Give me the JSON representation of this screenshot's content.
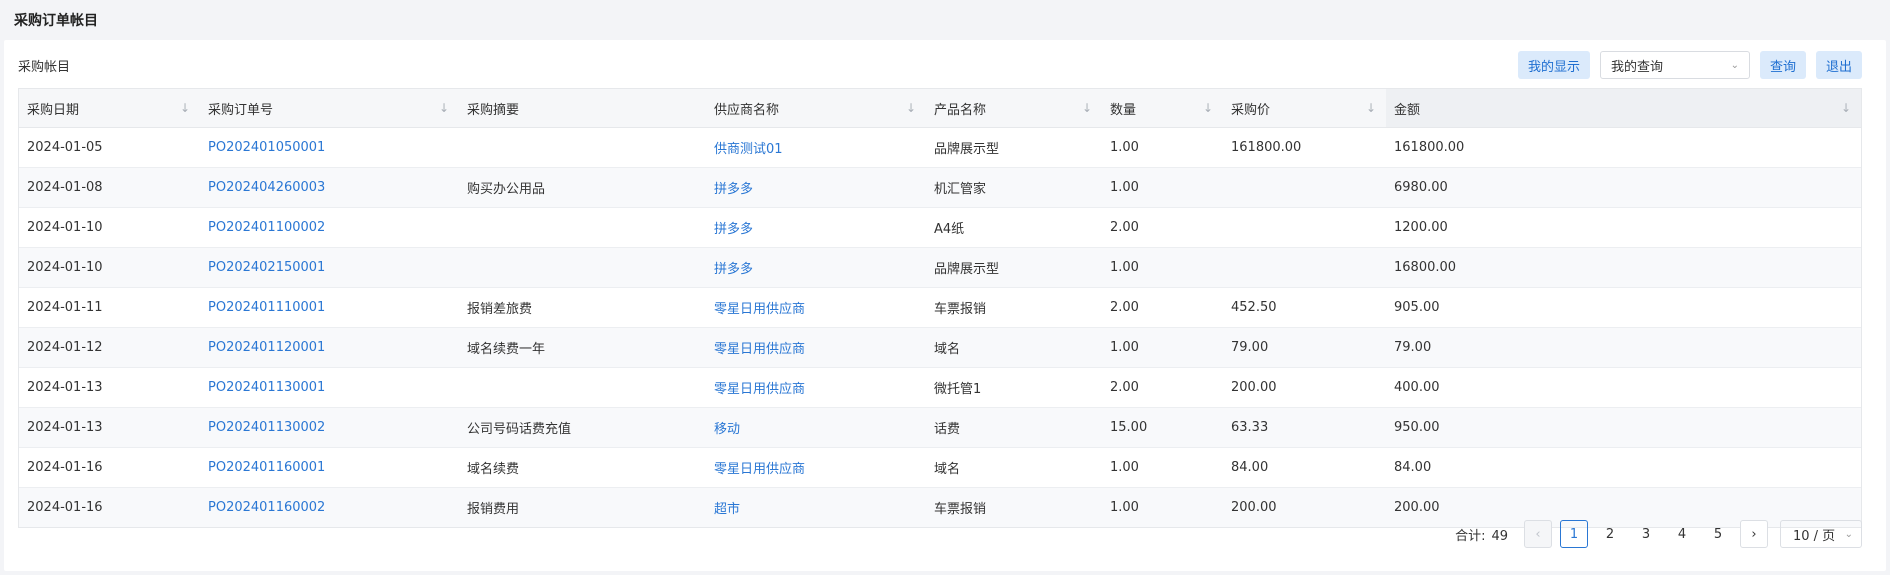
{
  "page": {
    "title": "采购订单帐目"
  },
  "toolbar": {
    "title": "采购帐目",
    "my_display_label": "我的显示",
    "my_query_selected": "我的查询",
    "query_label": "查询",
    "exit_label": "退出"
  },
  "table": {
    "columns": [
      "采购日期",
      "采购订单号",
      "采购摘要",
      "供应商名称",
      "产品名称",
      "数量",
      "采购价",
      "金额"
    ],
    "rows": [
      [
        "2024-01-05",
        "PO202401050001",
        "",
        "供商测试01",
        "品牌展示型",
        "1.00",
        "161800.00",
        "161800.00"
      ],
      [
        "2024-01-08",
        "PO202404260003",
        "购买办公用品",
        "拼多多",
        "机汇管家",
        "1.00",
        "",
        "6980.00"
      ],
      [
        "2024-01-10",
        "PO202401100002",
        "",
        "拼多多",
        "A4纸",
        "2.00",
        "",
        "1200.00"
      ],
      [
        "2024-01-10",
        "PO202402150001",
        "",
        "拼多多",
        "品牌展示型",
        "1.00",
        "",
        "16800.00"
      ],
      [
        "2024-01-11",
        "PO202401110001",
        "报销差旅费",
        "零星日用供应商",
        "车票报销",
        "2.00",
        "452.50",
        "905.00"
      ],
      [
        "2024-01-12",
        "PO202401120001",
        "域名续费一年",
        "零星日用供应商",
        "域名",
        "1.00",
        "79.00",
        "79.00"
      ],
      [
        "2024-01-13",
        "PO202401130001",
        "",
        "零星日用供应商",
        "微托管1",
        "2.00",
        "200.00",
        "400.00"
      ],
      [
        "2024-01-13",
        "PO202401130002",
        "公司号码话费充值",
        "移动",
        "话费",
        "15.00",
        "63.33",
        "950.00"
      ],
      [
        "2024-01-16",
        "PO202401160001",
        "域名续费",
        "零星日用供应商",
        "域名",
        "1.00",
        "84.00",
        "84.00"
      ],
      [
        "2024-01-16",
        "PO202401160002",
        "报销费用",
        "超市",
        "车票报销",
        "1.00",
        "200.00",
        "200.00"
      ]
    ]
  },
  "pagination": {
    "total_label": "合计:",
    "total": "49",
    "pages": [
      "1",
      "2",
      "3",
      "4",
      "5"
    ],
    "current": "1",
    "page_size": "10 / 页"
  },
  "icons": {
    "sort": "arrow-down-icon",
    "dropdown": "chevron-down-icon",
    "prev": "chevron-left-icon",
    "next": "chevron-right-icon"
  },
  "colors": {
    "link": "#2a77d4",
    "button_bg": "#dbeafb",
    "button_text": "#1f6fd1"
  }
}
